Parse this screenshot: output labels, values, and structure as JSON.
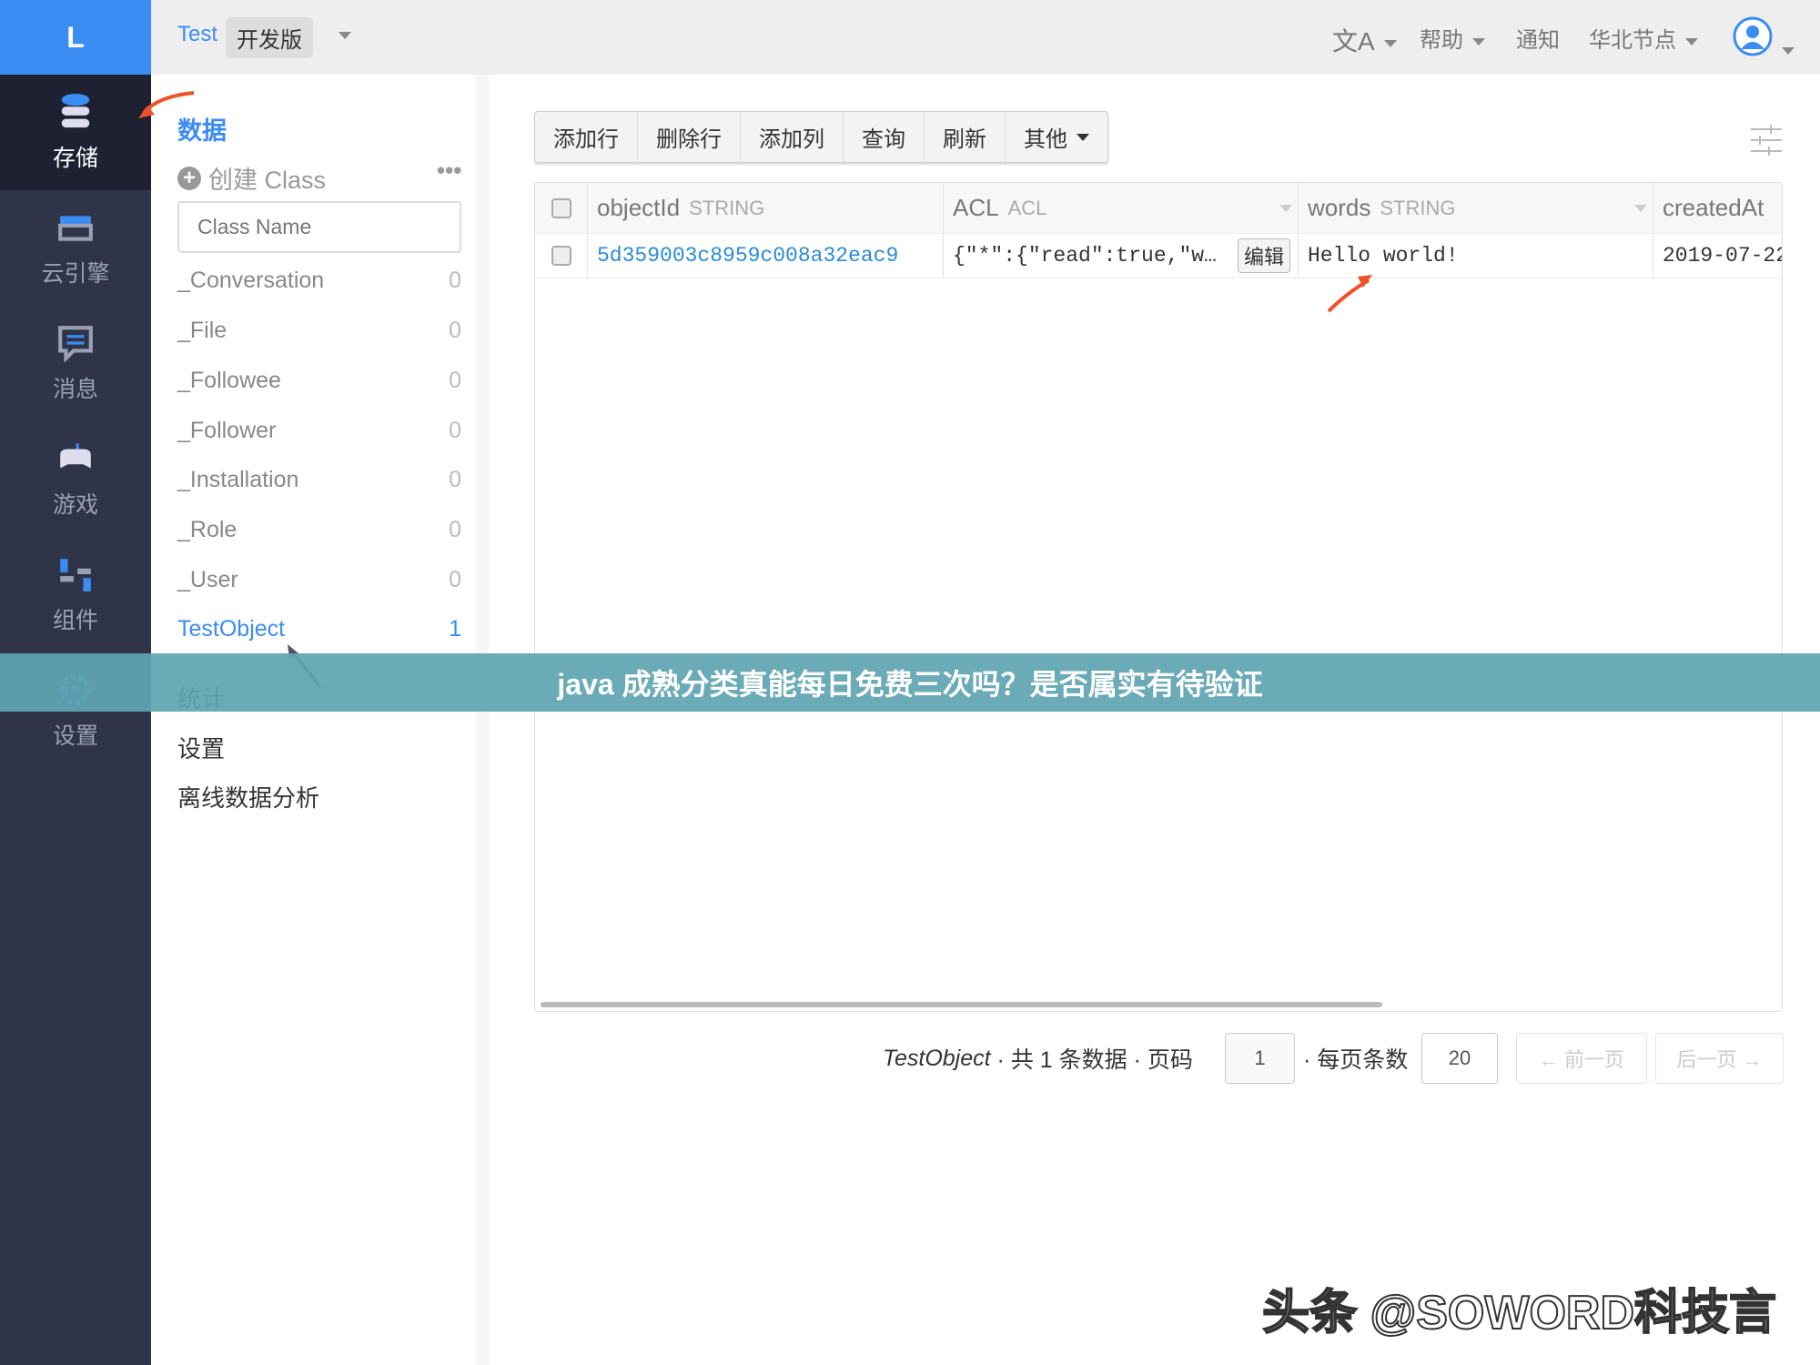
{
  "app": {
    "logo": "L",
    "project": "Test",
    "edition": "开发版"
  },
  "nav": [
    {
      "label": "存储",
      "icon": "database-icon"
    },
    {
      "label": "云引擎",
      "icon": "server-icon"
    },
    {
      "label": "消息",
      "icon": "message-icon"
    },
    {
      "label": "游戏",
      "icon": "gamepad-icon"
    },
    {
      "label": "组件",
      "icon": "components-icon"
    },
    {
      "label": "设置",
      "icon": "gear-icon"
    }
  ],
  "header": {
    "translate": "文A",
    "help": "帮助",
    "notify": "通知",
    "region": "华北节点"
  },
  "panel": {
    "section": "数据",
    "create": "创建 Class",
    "placeholder": "Class Name",
    "classes": [
      {
        "name": "_Conversation",
        "count": "0"
      },
      {
        "name": "_File",
        "count": "0"
      },
      {
        "name": "_Followee",
        "count": "0"
      },
      {
        "name": "_Follower",
        "count": "0"
      },
      {
        "name": "_Installation",
        "count": "0"
      },
      {
        "name": "_Role",
        "count": "0"
      },
      {
        "name": "_User",
        "count": "0"
      },
      {
        "name": "TestObject",
        "count": "1"
      }
    ],
    "stats": "统计",
    "settings": "设置",
    "offline": "离线数据分析"
  },
  "toolbar": {
    "add_row": "添加行",
    "del_row": "删除行",
    "add_col": "添加列",
    "query": "查询",
    "refresh": "刷新",
    "other": "其他"
  },
  "table": {
    "columns": [
      {
        "name": "objectId",
        "type": "STRING"
      },
      {
        "name": "ACL",
        "type": "ACL"
      },
      {
        "name": "words",
        "type": "STRING"
      },
      {
        "name": "createdAt",
        "type": ""
      }
    ],
    "rows": [
      {
        "objectId": "5d359003c8959c008a32eac9",
        "acl": "{\"*\":{\"read\":true,\"w…",
        "edit": "编辑",
        "words": "Hello world!",
        "createdAt": "2019-07-22"
      }
    ]
  },
  "pagination": {
    "class": "TestObject",
    "total": "· 共 1 条数据 · 页码",
    "page": "1",
    "per_label": "· 每页条数",
    "per": "20",
    "prev": "← 前一页",
    "next": "后一页 →"
  },
  "banner": "java 成熟分类真能每日免费三次吗？是否属实有待验证",
  "watermark": "头条 @SOWORD科技言",
  "colors": {
    "accent": "#3b8cf3",
    "nav": "#2f3449",
    "arrow": "#f0502a",
    "banner": "#60a5b2"
  }
}
